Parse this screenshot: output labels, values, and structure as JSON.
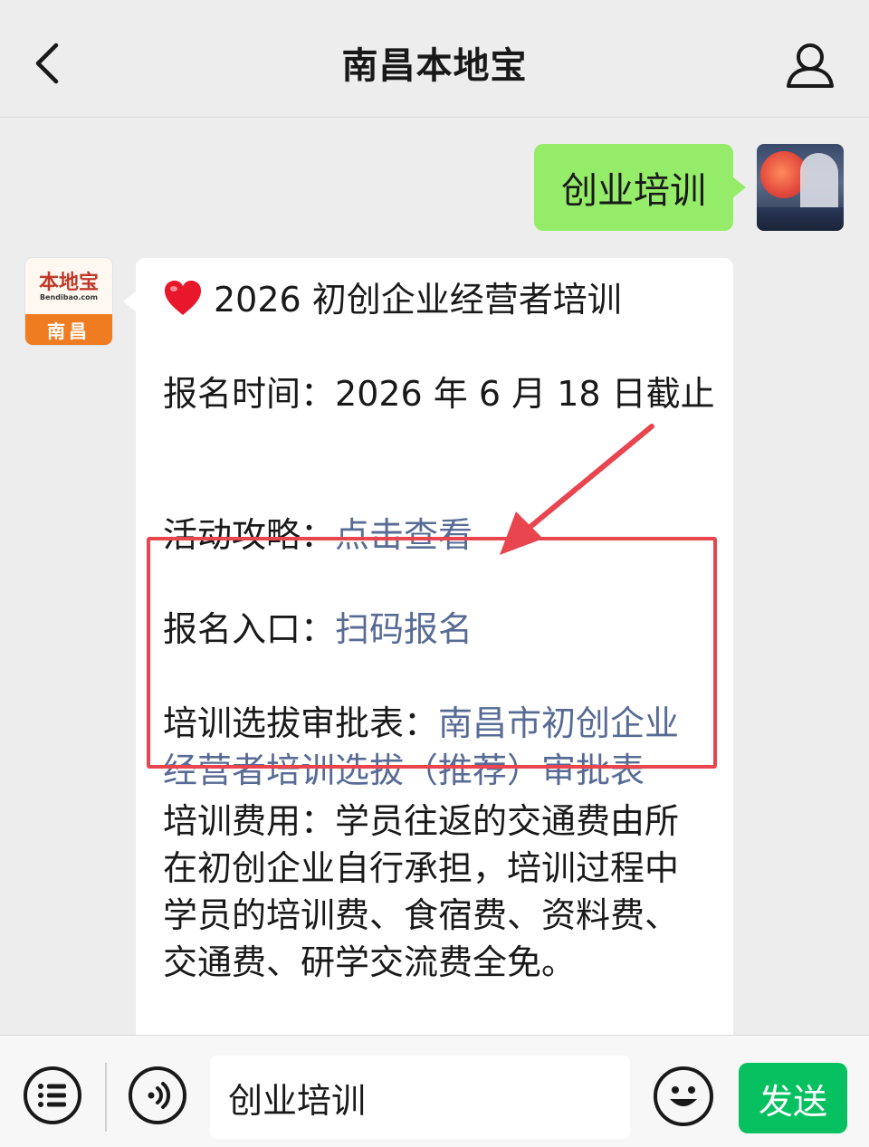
{
  "header": {
    "title": "南昌本地宝",
    "back_icon": "chevron-left-icon",
    "profile_icon": "person-icon"
  },
  "chat": {
    "outgoing": {
      "text": "创业培训"
    },
    "incoming": {
      "bot_avatar": {
        "brand": "本地宝",
        "url": "Bendibao.com",
        "city": "南昌"
      },
      "title": "2026 初创企业经营者培训",
      "deadline_label": "报名时间：",
      "deadline_value": "2026 年 6 月 18 日截止",
      "guide_label": "活动攻略：",
      "guide_link": "点击查看",
      "register_label": "报名入口：",
      "register_link": "扫码报名",
      "form_label": "培训选拔审批表：",
      "form_link_line1": "南昌市初创企业",
      "form_link_line2": "经营者培训选拔（推荐）审批表",
      "fee_line1": "培训费用：学员往返的交通费由所",
      "fee_line2": "在初创企业自行承担，培训过程中",
      "fee_line3": "学员的培训费、食宿费、资料费、",
      "fee_line4": "交通费、研学交流费全免。"
    }
  },
  "bottom_bar": {
    "input_value": "创业培训",
    "send_label": "发送"
  },
  "colors": {
    "link": "#576b95",
    "outgoing_bubble": "#95ec69",
    "send_button": "#07c160",
    "highlight": "#e8454f"
  }
}
